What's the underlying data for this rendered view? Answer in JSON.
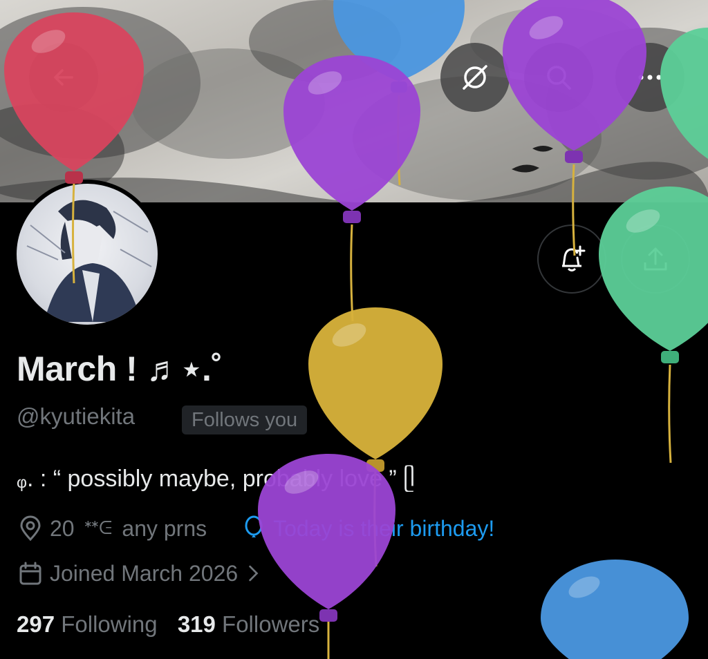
{
  "profile": {
    "display_name": "March ! ♬⋆.˚",
    "handle": "@kyutiekita",
    "follows_you": "Follows you",
    "bio": "ᵩ. : “ possibly maybe, probably love ” ᥫ",
    "location": "20",
    "pronoun_glyphs": "ᕯᕮ",
    "pronouns": "any prns",
    "birthday": "Today is their birthday!",
    "joined": "Joined March 2026",
    "following_count": "297",
    "following_label": "Following",
    "followers_count": "319",
    "followers_label": "Followers"
  },
  "icons": {
    "back": "arrow-left-icon",
    "grok": "grok-slash-circle-icon",
    "search": "search-icon",
    "more": "more-dots-icon",
    "notify": "bell-plus-icon",
    "share": "share-upload-icon",
    "location": "map-pin-icon",
    "birthday": "balloon-icon",
    "calendar": "calendar-icon"
  },
  "colors": {
    "background": "#000000",
    "text_primary": "#e7e9ea",
    "text_secondary": "#71767b",
    "link": "#1d9bf0",
    "balloon_red": "#d8455e",
    "balloon_purple": "#9b44d4",
    "balloon_blue": "#4a96df",
    "balloon_yellow": "#d6b13a",
    "balloon_green": "#5ccf98"
  }
}
